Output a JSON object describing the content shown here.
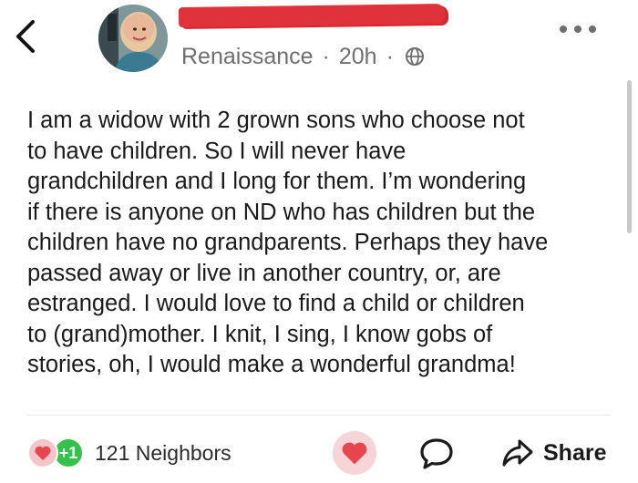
{
  "header": {
    "back_icon": "chevron-left-icon",
    "author_name_redacted": true,
    "neighborhood": "Renaissance",
    "separator": "·",
    "time_ago": "20h",
    "visibility_icon": "globe-icon",
    "more_icon": "more-horizontal-icon"
  },
  "post": {
    "body": "I am a widow with 2 grown sons who choose not\nto have children. So I will never have\ngrandchildren and I long for them. I’m wondering\nif there is anyone on ND who has children but the\nchildren have no grandparents. Perhaps they have\npassed away or live in another country, or, are\nestranged. I would love to find a child or children\nto (grand)mother. I knit, I sing, I know gobs of\nstories, oh, I would make a wonderful grandma!"
  },
  "footer": {
    "reaction_heart_icon": "heart-icon",
    "reaction_plus_label": "+1",
    "reaction_count": "121 Neighbors",
    "like_icon": "heart-icon",
    "comment_icon": "comment-icon",
    "share_icon": "share-arrow-icon",
    "share_label": "Share"
  },
  "colors": {
    "redaction": "#e0323a",
    "heart": "#e8454f",
    "plus_badge": "#35c24a",
    "muted_text": "#6f6f6f"
  }
}
